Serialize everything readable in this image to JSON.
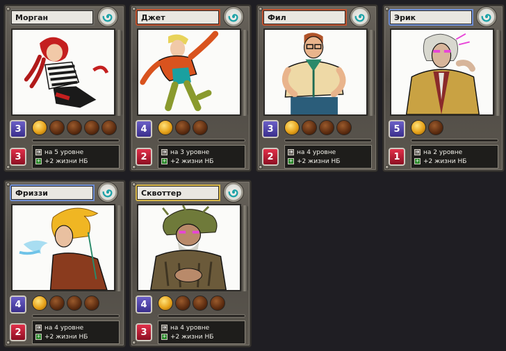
{
  "colors": {
    "background": "#1f1e23",
    "trim_red": "#c0522f",
    "trim_blue": "#6f8fd6",
    "trim_gold": "#d8b84a",
    "level_badge": "#4a3fa8",
    "health_badge": "#c01a34",
    "ability_filled_orb": "#f1b92a",
    "ability_empty_orb": "#6a3416"
  },
  "icons": {
    "header": "spiral-icon",
    "bonus_cost": "arrow-icon",
    "bonus_hp": "plus-icon"
  },
  "characters": [
    {
      "name": "Морган",
      "level": "3",
      "health": "3",
      "orbs_total": 5,
      "orbs_filled": 1,
      "xp_progress": 0.05,
      "ability_line1": "на 5 уровне",
      "ability_line2": "+2 жизни НБ",
      "trim": "#6b6963"
    },
    {
      "name": "Джет",
      "level": "4",
      "health": "2",
      "orbs_total": 3,
      "orbs_filled": 1,
      "xp_progress": 0.1,
      "ability_line1": "на 3 уровне",
      "ability_line2": "+2 жизни НБ",
      "trim": "#c0522f"
    },
    {
      "name": "Фил",
      "level": "3",
      "health": "2",
      "orbs_total": 4,
      "orbs_filled": 1,
      "xp_progress": 0.05,
      "ability_line1": "на 4 уровне",
      "ability_line2": "+2 жизни НБ",
      "trim": "#c0522f"
    },
    {
      "name": "Эрик",
      "level": "5",
      "health": "1",
      "orbs_total": 2,
      "orbs_filled": 1,
      "xp_progress": 0.05,
      "ability_line1": "на 2 уровне",
      "ability_line2": "+2 жизни НБ",
      "trim": "#6f8fd6"
    },
    {
      "name": "Фриззи",
      "level": "4",
      "health": "2",
      "orbs_total": 4,
      "orbs_filled": 1,
      "xp_progress": 0.05,
      "ability_line1": "на 4 уровне",
      "ability_line2": "+2 жизни НБ",
      "trim": "#6f8fd6"
    },
    {
      "name": "Сквоттер",
      "level": "4",
      "health": "3",
      "orbs_total": 4,
      "orbs_filled": 1,
      "xp_progress": 0.05,
      "ability_line1": "на 4 уровне",
      "ability_line2": "+2 жизни НБ",
      "trim": "#d8b84a"
    }
  ]
}
